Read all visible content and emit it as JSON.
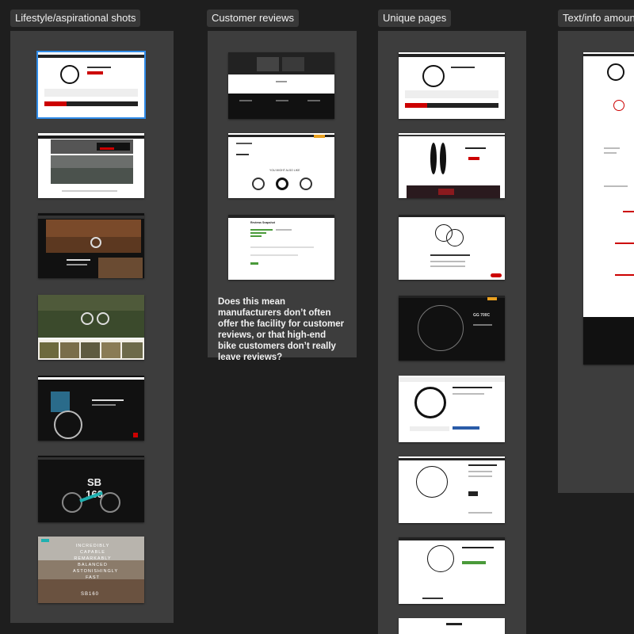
{
  "columns": [
    {
      "label": "Lifestyle/aspirational shots"
    },
    {
      "label": "Customer reviews"
    },
    {
      "label": "Unique pages"
    },
    {
      "label": "Text/info amount"
    }
  ],
  "note": "Does this mean manufacturers don’t often offer the facility for customer reviews, or that high-end bike customers don’t really leave reviews?",
  "thumb_text": {
    "sb_top": "SB",
    "sb_bottom": "160",
    "incredibly": "INCREDIBLY CAPABLE REMARKABLY BALANCED ASTONISHINGLY FAST",
    "sb_mark": "SB160",
    "reviews_heading": "Reviews Snapshot",
    "also_like": "YOU MIGHT ALSO LIKE",
    "gg_title": "GG 700C"
  },
  "colors": {
    "accent": "#2f8be8",
    "panel": "#3d3d3d",
    "background": "#1e1e1e"
  }
}
